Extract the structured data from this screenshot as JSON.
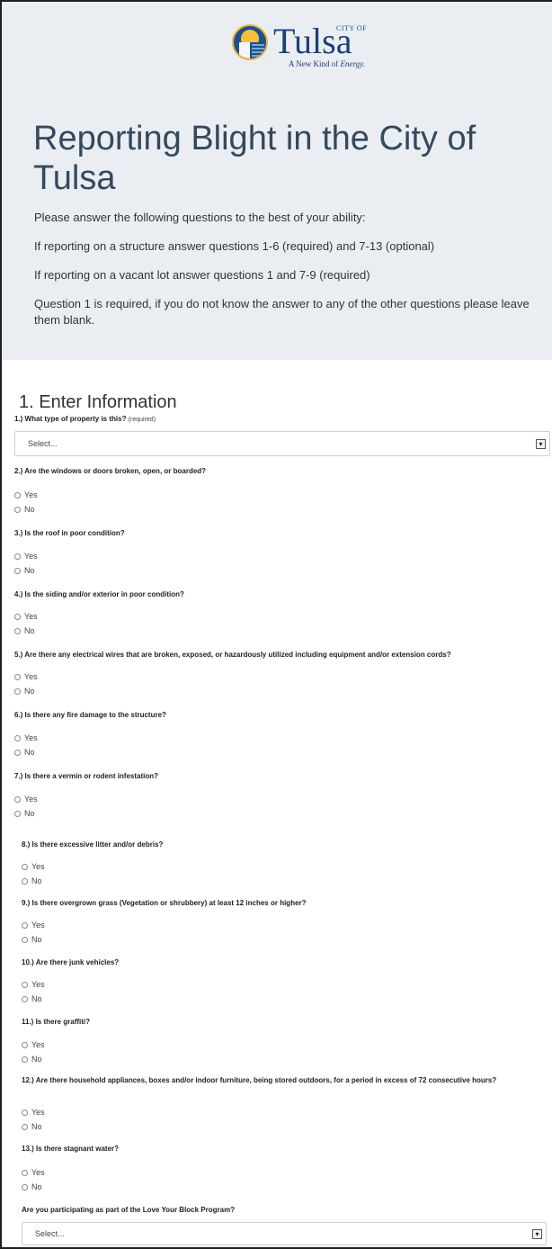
{
  "logo": {
    "city_of": "CITY OF",
    "word": "Tulsa",
    "tagline_a": "A New Kind of",
    "tagline_b": "Energy."
  },
  "title": "Reporting Blight in the City of Tulsa",
  "intro": [
    "Please answer the following questions to the best of your ability:",
    "If reporting on a structure answer questions 1-6 (required) and 7-13 (optional)",
    "If reporting on a vacant lot answer questions 1 and 7-9 (required)",
    "Question 1 is required, if you do not know the answer to any of the other questions please leave them blank."
  ],
  "section_title": "1. Enter Information",
  "q1": {
    "label": "1.) What type of property is this?",
    "req": "(required)",
    "placeholder": "Select..."
  },
  "options": {
    "yes": "Yes",
    "no": "No"
  },
  "questions": [
    "2.) Are the windows or doors broken, open, or boarded?",
    "3.) Is the roof in poor condition?",
    "4.) Is the siding and/or exterior in poor condition?",
    "5.) Are there any electrical wires that are broken, exposed, or hazardously utilized including equipment and/or extension cords?",
    "6.) Is there any fire damage to the structure?",
    "7.) Is there a vermin or rodent infestation?",
    "8.) Is there excessive litter and/or debris?",
    "9.) Is there overgrown grass (Vegetation or shrubbery) at least 12 inches or higher?",
    "10.) Are there junk vehicles?",
    "11.) Is there graffiti?",
    "12.) Are there household appliances, boxes and/or indoor furniture, being stored outdoors, for a period in excess of 72 consecutive hours?",
    "13.) Is there stagnant water?"
  ],
  "love_block": {
    "label": "Are you participating as part of the Love Your Block Program?",
    "placeholder": "Select..."
  },
  "arrow_glyph": "▾"
}
